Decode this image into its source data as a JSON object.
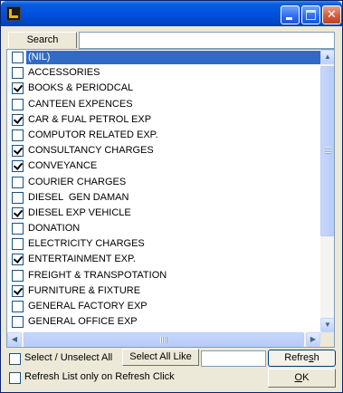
{
  "window": {
    "title": "",
    "buttons": {
      "minimize": "minimize",
      "maximize": "maximize",
      "close": "✕"
    }
  },
  "search": {
    "tab_label": "Search",
    "value": ""
  },
  "list": {
    "items": [
      {
        "label": "(NIL)",
        "checked": false,
        "selected": true
      },
      {
        "label": "ACCESSORIES",
        "checked": false,
        "selected": false
      },
      {
        "label": "BOOKS & PERIODCAL",
        "checked": true,
        "selected": false
      },
      {
        "label": "CANTEEN EXPENCES",
        "checked": false,
        "selected": false
      },
      {
        "label": "CAR & FUAL PETROL EXP",
        "checked": true,
        "selected": false
      },
      {
        "label": "COMPUTOR RELATED EXP.",
        "checked": false,
        "selected": false
      },
      {
        "label": "CONSULTANCY CHARGES",
        "checked": true,
        "selected": false
      },
      {
        "label": "CONVEYANCE",
        "checked": true,
        "selected": false
      },
      {
        "label": "COURIER CHARGES",
        "checked": false,
        "selected": false
      },
      {
        "label": "DIESEL  GEN DAMAN",
        "checked": false,
        "selected": false
      },
      {
        "label": "DIESEL EXP VEHICLE",
        "checked": true,
        "selected": false
      },
      {
        "label": "DONATION",
        "checked": false,
        "selected": false
      },
      {
        "label": "ELECTRICITY CHARGES",
        "checked": false,
        "selected": false
      },
      {
        "label": "ENTERTAINMENT EXP.",
        "checked": true,
        "selected": false
      },
      {
        "label": "FREIGHT & TRANSPOTATION",
        "checked": false,
        "selected": false
      },
      {
        "label": "FURNITURE & FIXTURE",
        "checked": true,
        "selected": false
      },
      {
        "label": "GENERAL FACTORY EXP",
        "checked": false,
        "selected": false
      },
      {
        "label": "GENERAL OFFICE EXP",
        "checked": false,
        "selected": false
      }
    ]
  },
  "footer": {
    "select_unselect_all": "Select / Unselect All",
    "select_all_like": "Select All Like",
    "like_value": "",
    "refresh_prefix": "Refre",
    "refresh_underlined": "s",
    "refresh_suffix": "h",
    "refresh_only_on_click": "Refresh List only on Refresh Click",
    "ok_underlined": "O",
    "ok_suffix": "K"
  },
  "colors": {
    "title_bar": "#0054e3",
    "selection": "#316ac5",
    "window_bg": "#ece9d8"
  }
}
